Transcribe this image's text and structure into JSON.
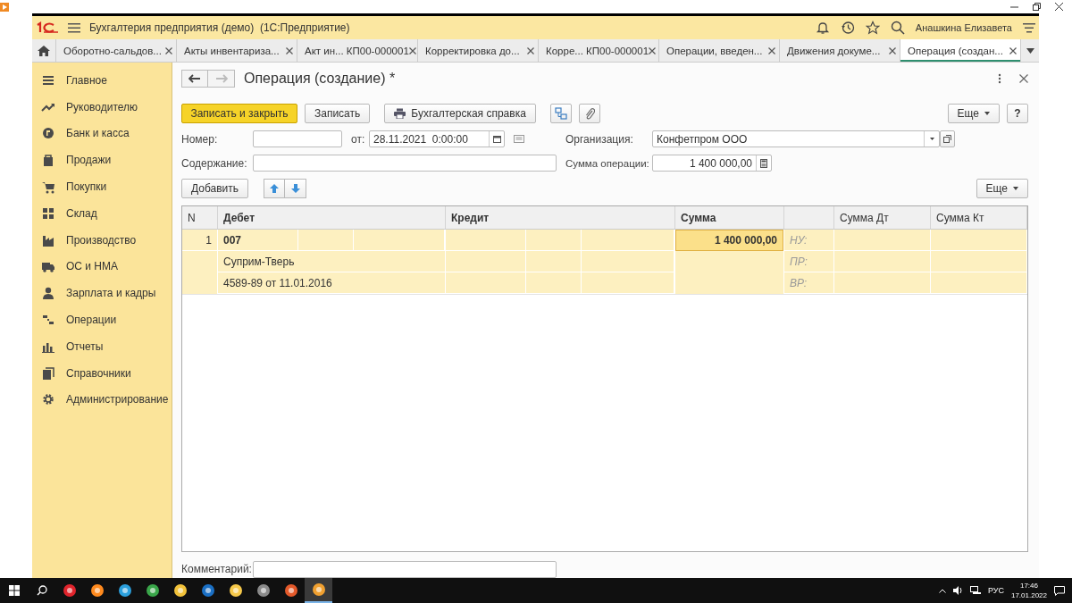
{
  "app": {
    "title": "Бухгалтерия предприятия (демо)  (1С:Предприятие)",
    "user": "Анашкина Елизавета"
  },
  "tabs": [
    {
      "label": "Оборотно-сальдов...",
      "selected": false
    },
    {
      "label": "Акты инвентариза...",
      "selected": false
    },
    {
      "label": "Акт ин... КП00-000001",
      "selected": false
    },
    {
      "label": "Корректировка до...",
      "selected": false
    },
    {
      "label": "Корре... КП00-000001",
      "selected": false
    },
    {
      "label": "Операции, введен...",
      "selected": false
    },
    {
      "label": "Движения докуме...",
      "selected": false
    },
    {
      "label": "Операция (создан...",
      "selected": true
    }
  ],
  "sidebar": {
    "items": [
      {
        "label": "Главное"
      },
      {
        "label": "Руководителю"
      },
      {
        "label": "Банк и касса"
      },
      {
        "label": "Продажи"
      },
      {
        "label": "Покупки"
      },
      {
        "label": "Склад"
      },
      {
        "label": "Производство"
      },
      {
        "label": "ОС и НМА"
      },
      {
        "label": "Зарплата и кадры"
      },
      {
        "label": "Операции"
      },
      {
        "label": "Отчеты"
      },
      {
        "label": "Справочники"
      },
      {
        "label": "Администрирование"
      }
    ]
  },
  "form": {
    "title": "Операция (создание) *",
    "toolbar": {
      "primary": "Записать и закрыть",
      "save": "Записать",
      "report": "Бухгалтерская справка",
      "more": "Еще",
      "help": "?"
    },
    "number": {
      "label": "Номер:"
    },
    "date": {
      "label": "от:",
      "value": "28.11.2021  0:00:00"
    },
    "organization": {
      "label": "Организация:",
      "value": "Конфетпром ООО"
    },
    "content": {
      "label": "Содержание:"
    },
    "amount": {
      "label": "Сумма операции:",
      "value": "1 400 000,00"
    },
    "table_toolbar": {
      "add": "Добавить",
      "more": "Еще"
    },
    "comment": {
      "label": "Комментарий:"
    }
  },
  "table": {
    "columns": [
      "N",
      "Дебет",
      "Кредит",
      "Сумма",
      "Сумма Дт",
      "Сумма Кт"
    ],
    "rows": [
      {
        "n": "1",
        "selected": true,
        "debit": [
          "007",
          "Суприм-Тверь",
          "4589-89 от 11.01.2016"
        ],
        "sum": "1 400 000,00",
        "sum_selected": true,
        "tax_labels": [
          "НУ:",
          "ПР:",
          "ВР:"
        ]
      }
    ]
  },
  "taskbar": {
    "apps": [
      {
        "selected": false
      },
      {
        "selected": false
      },
      {
        "selected": false
      },
      {
        "selected": false
      },
      {
        "selected": false
      },
      {
        "selected": false
      },
      {
        "selected": false
      },
      {
        "selected": false
      },
      {
        "selected": false
      },
      {
        "selected": true
      }
    ],
    "language": "РУС",
    "time": "17:46",
    "date": "17.01.2022"
  }
}
